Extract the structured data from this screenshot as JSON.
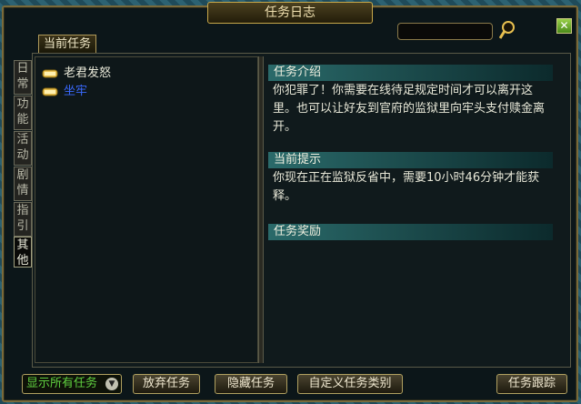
{
  "window": {
    "title": "任务日志"
  },
  "tabs": {
    "main": "当前任务"
  },
  "side_tabs": [
    {
      "label": "日常",
      "active": false
    },
    {
      "label": "功能",
      "active": false
    },
    {
      "label": "活动",
      "active": false
    },
    {
      "label": "剧情",
      "active": false
    },
    {
      "label": "指引",
      "active": false
    },
    {
      "label": "其他",
      "active": true
    }
  ],
  "quests": [
    {
      "name": "老君发怒",
      "selected": false
    },
    {
      "name": "坐牢",
      "selected": true
    }
  ],
  "detail": {
    "intro_title": "任务介绍",
    "intro_text": "你犯罪了！你需要在线待足规定时间才可以离开这里。也可以让好友到官府的监狱里向牢头支付赎金离开。",
    "hint_title": "当前提示",
    "hint_text": "你现在正在监狱反省中，需要10小时46分钟才能获释。",
    "reward_title": "任务奖励"
  },
  "buttons": {
    "filter": "显示所有任务",
    "abandon": "放弃任务",
    "hide": "隐藏任务",
    "custom": "自定义任务类别",
    "track": "任务跟踪"
  },
  "icons": {
    "close": "close-icon",
    "search": "magnifier-icon",
    "quest": "scroll-icon",
    "dropdown": "chevron-down-icon"
  },
  "colors": {
    "accent": "#c8a84a",
    "selected_quest": "#3a6aff",
    "filter_text": "#60d040"
  }
}
